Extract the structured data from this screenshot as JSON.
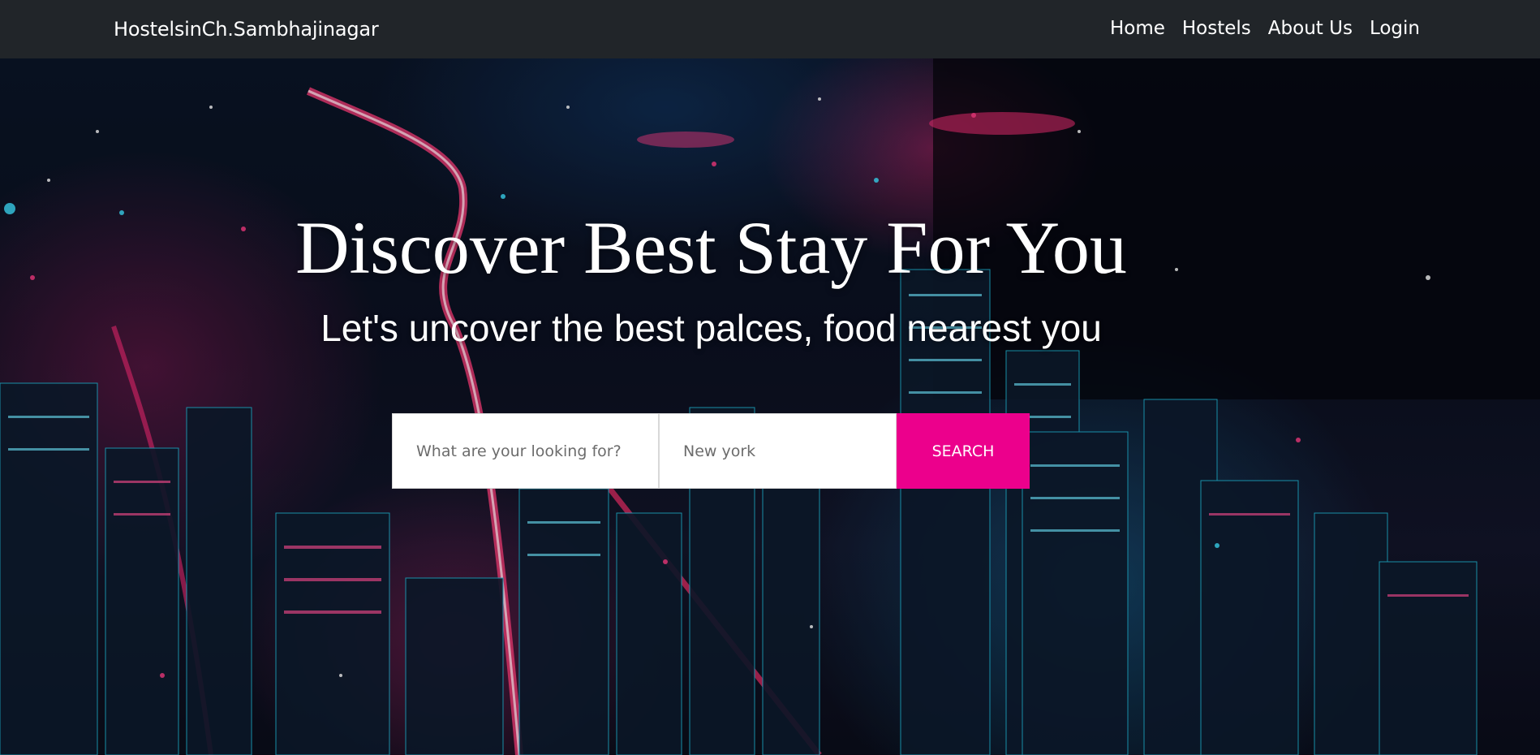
{
  "navbar": {
    "brand": "HostelsinCh.Sambhajinagar",
    "links": [
      {
        "label": "Home"
      },
      {
        "label": "Hostels"
      },
      {
        "label": "About Us"
      },
      {
        "label": "Login"
      }
    ]
  },
  "hero": {
    "title": "Discover Best Stay For You",
    "subtitle": "Let's uncover the best palces, food nearest you",
    "background": "night-city-skyline-image",
    "search": {
      "what_placeholder": "What are your looking for?",
      "where_placeholder": "New york",
      "button_label": "SEARCH"
    }
  },
  "colors": {
    "navbar_bg": "#212529",
    "accent": "#ec008c",
    "text_light": "#ffffff"
  }
}
